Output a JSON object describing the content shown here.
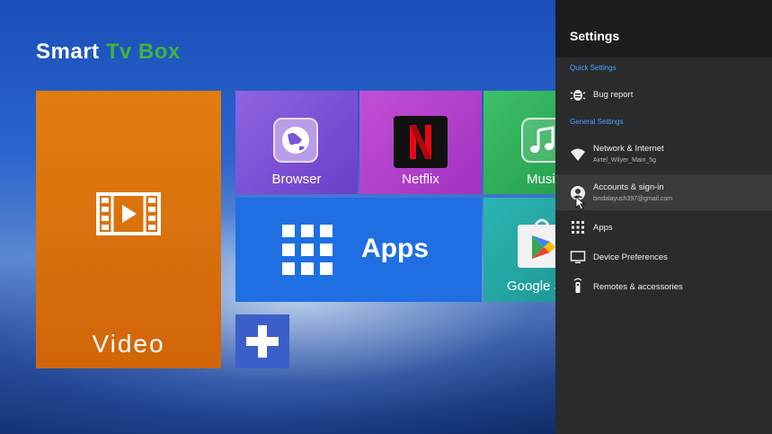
{
  "brand": {
    "part1": "Smart ",
    "part2": "Tv Box",
    "accent_color": "#3fb33f"
  },
  "tiles": {
    "video": {
      "label": "Video",
      "icon": "video-film-icon"
    },
    "browser": {
      "label": "Browser",
      "icon": "globe-icon"
    },
    "netflix": {
      "label": "Netflix",
      "icon": "netflix-n-icon",
      "logo_letter": "N"
    },
    "music": {
      "label": "Music",
      "icon": "music-note-icon"
    },
    "apps": {
      "label": "Apps",
      "icon": "grid-icon"
    },
    "google_play": {
      "label": "Google S",
      "icon": "play-store-icon"
    },
    "add": {
      "icon": "plus-icon"
    }
  },
  "settings": {
    "title": "Settings",
    "quick_label": "Quick Settings",
    "general_label": "General Settings",
    "items": [
      {
        "title": "Bug report",
        "subtitle": "",
        "icon": "bug-icon"
      },
      {
        "title": "Network & Internet",
        "subtitle": "Airtel_Wilyer_Main_5g",
        "icon": "wifi-icon"
      },
      {
        "title": "Accounts & sign-in",
        "subtitle": "bindalayush397@gmail.com",
        "icon": "account-icon"
      },
      {
        "title": "Apps",
        "subtitle": "",
        "icon": "apps-grid-icon"
      },
      {
        "title": "Device Preferences",
        "subtitle": "",
        "icon": "tv-icon"
      },
      {
        "title": "Remotes & accessories",
        "subtitle": "",
        "icon": "remote-icon"
      }
    ],
    "accent_color": "#4da3ff"
  }
}
